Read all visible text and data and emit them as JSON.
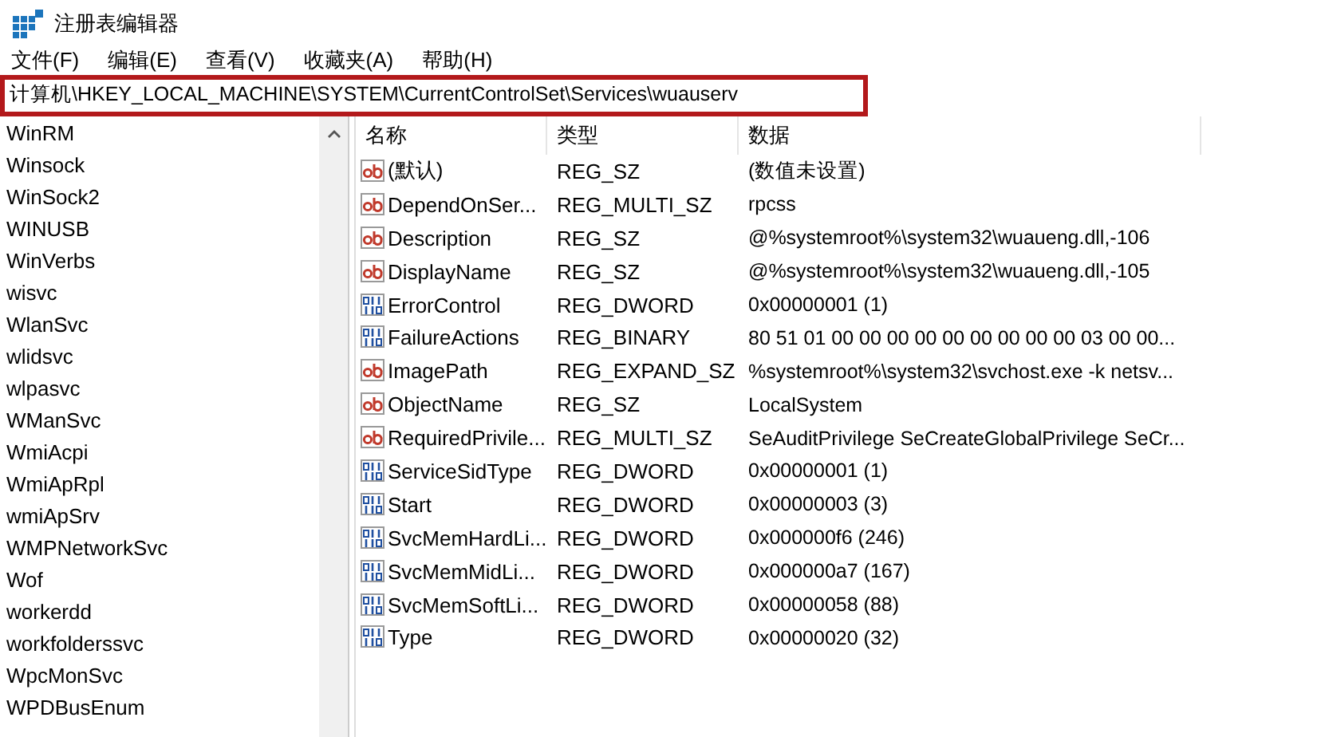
{
  "window": {
    "title": "注册表编辑器"
  },
  "menu": [
    "文件(F)",
    "编辑(E)",
    "查看(V)",
    "收藏夹(A)",
    "帮助(H)"
  ],
  "address_bar": {
    "value": "计算机\\HKEY_LOCAL_MACHINE\\SYSTEM\\CurrentControlSet\\Services\\wuauserv",
    "highlighted": true
  },
  "tree": {
    "items": [
      "WinRM",
      "Winsock",
      "WinSock2",
      "WINUSB",
      "WinVerbs",
      "wisvc",
      "WlanSvc",
      "wlidsvc",
      "wlpasvc",
      "WManSvc",
      "WmiAcpi",
      "WmiApRpl",
      "wmiApSrv",
      "WMPNetworkSvc",
      "Wof",
      "workerdd",
      "workfolderssvc",
      "WpcMonSvc",
      "WPDBusEnum"
    ]
  },
  "table": {
    "columns": [
      "名称",
      "类型",
      "数据"
    ],
    "rows": [
      {
        "kind": "string",
        "name": "(默认)",
        "type": "REG_SZ",
        "data": "(数值未设置)"
      },
      {
        "kind": "string",
        "name": "DependOnSer...",
        "type": "REG_MULTI_SZ",
        "data": "rpcss"
      },
      {
        "kind": "string",
        "name": "Description",
        "type": "REG_SZ",
        "data": "@%systemroot%\\system32\\wuaueng.dll,-106"
      },
      {
        "kind": "string",
        "name": "DisplayName",
        "type": "REG_SZ",
        "data": "@%systemroot%\\system32\\wuaueng.dll,-105"
      },
      {
        "kind": "binary",
        "name": "ErrorControl",
        "type": "REG_DWORD",
        "data": "0x00000001 (1)"
      },
      {
        "kind": "binary",
        "name": "FailureActions",
        "type": "REG_BINARY",
        "data": "80 51 01 00 00 00 00 00 00 00 00 00 03 00 00..."
      },
      {
        "kind": "string",
        "name": "ImagePath",
        "type": "REG_EXPAND_SZ",
        "data": "%systemroot%\\system32\\svchost.exe -k netsv..."
      },
      {
        "kind": "string",
        "name": "ObjectName",
        "type": "REG_SZ",
        "data": "LocalSystem"
      },
      {
        "kind": "string",
        "name": "RequiredPrivile...",
        "type": "REG_MULTI_SZ",
        "data": "SeAuditPrivilege SeCreateGlobalPrivilege SeCr..."
      },
      {
        "kind": "binary",
        "name": "ServiceSidType",
        "type": "REG_DWORD",
        "data": "0x00000001 (1)"
      },
      {
        "kind": "binary",
        "name": "Start",
        "type": "REG_DWORD",
        "data": "0x00000003 (3)"
      },
      {
        "kind": "binary",
        "name": "SvcMemHardLi...",
        "type": "REG_DWORD",
        "data": "0x000000f6 (246)"
      },
      {
        "kind": "binary",
        "name": "SvcMemMidLi...",
        "type": "REG_DWORD",
        "data": "0x000000a7 (167)"
      },
      {
        "kind": "binary",
        "name": "SvcMemSoftLi...",
        "type": "REG_DWORD",
        "data": "0x00000058 (88)"
      },
      {
        "kind": "binary",
        "name": "Type",
        "type": "REG_DWORD",
        "data": "0x00000020 (32)"
      }
    ]
  }
}
